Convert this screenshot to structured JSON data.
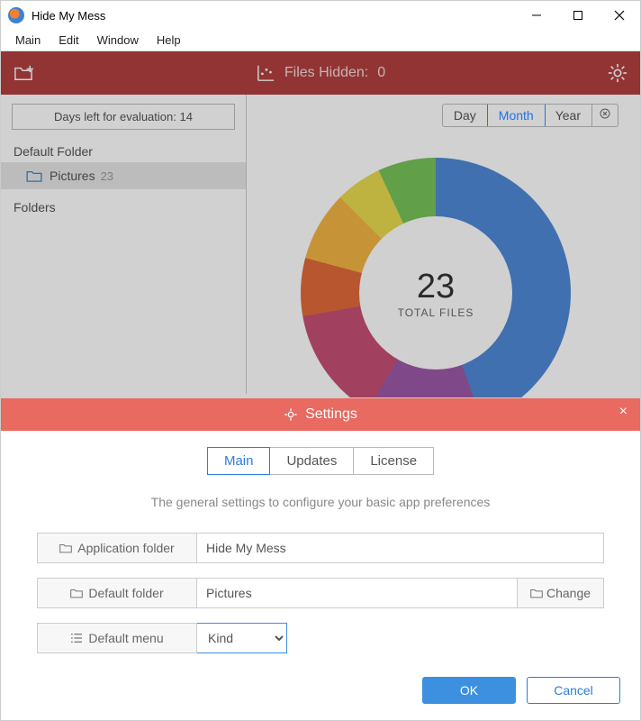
{
  "window": {
    "title": "Hide My Mess"
  },
  "menu": {
    "items": [
      "Main",
      "Edit",
      "Window",
      "Help"
    ]
  },
  "toolbar": {
    "files_hidden_label": "Files Hidden:",
    "files_hidden_count": "0"
  },
  "sidebar": {
    "eval_label": "Days left for evaluation:",
    "eval_days": "14",
    "default_folder_label": "Default Folder",
    "folders_label": "Folders",
    "selected_folder": {
      "name": "Pictures",
      "count": "23"
    }
  },
  "timeframe": {
    "options": [
      "Day",
      "Month",
      "Year"
    ],
    "selected": "Month"
  },
  "chart_data": {
    "type": "pie",
    "title": "",
    "total_label": "TOTAL FILES",
    "total_value": "23",
    "series": [
      {
        "name": "slice-1",
        "value": 10.2,
        "color": "#4f89d6"
      },
      {
        "name": "slice-2",
        "value": 3.2,
        "color": "#9c5aa8"
      },
      {
        "name": "slice-3",
        "value": 3.2,
        "color": "#c55074"
      },
      {
        "name": "slice-4",
        "value": 1.6,
        "color": "#e06a3a"
      },
      {
        "name": "slice-5",
        "value": 1.9,
        "color": "#f2b544"
      },
      {
        "name": "slice-6",
        "value": 1.3,
        "color": "#e8d94f"
      },
      {
        "name": "slice-7",
        "value": 1.6,
        "color": "#78c25a"
      }
    ]
  },
  "settings": {
    "title": "Settings",
    "tabs": [
      "Main",
      "Updates",
      "License"
    ],
    "active_tab": "Main",
    "description": "The general settings to configure your basic app preferences",
    "fields": {
      "app_folder_label": "Application folder",
      "app_folder_value": "Hide My Mess",
      "default_folder_label": "Default folder",
      "default_folder_value": "Pictures",
      "change_label": "Change",
      "default_menu_label": "Default menu",
      "default_menu_value": "Kind"
    },
    "buttons": {
      "ok": "OK",
      "cancel": "Cancel"
    }
  }
}
